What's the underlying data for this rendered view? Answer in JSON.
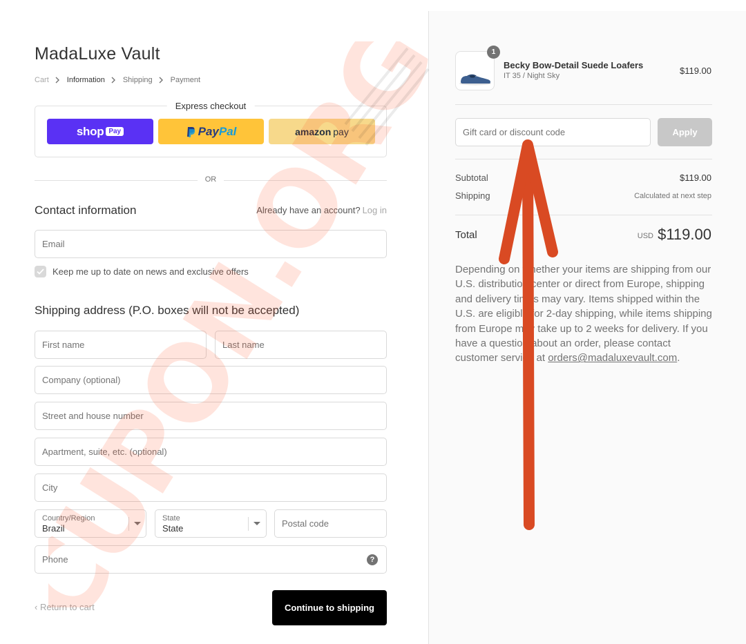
{
  "store": {
    "title": "MadaLuxe Vault"
  },
  "breadcrumb": [
    "Cart",
    "Information",
    "Shipping",
    "Payment"
  ],
  "express": {
    "title": "Express checkout",
    "shop_pay": {
      "word": "shop",
      "badge": "Pay"
    },
    "paypal": {
      "p1": "Pay",
      "p2": "Pal"
    },
    "amazon": {
      "word": "amazon",
      "pay": "pay"
    }
  },
  "or_label": "OR",
  "contact": {
    "title": "Contact information",
    "account_prompt": "Already have an account?",
    "login_link": "Log in",
    "email_placeholder": "Email",
    "newsletter_label": "Keep me up to date on news and exclusive offers"
  },
  "shipping": {
    "title": "Shipping address (P.O. boxes will not be accepted)",
    "first_name": "First name",
    "last_name": "Last name",
    "company": "Company (optional)",
    "street": "Street and house number",
    "apartment": "Apartment, suite, etc. (optional)",
    "city": "City",
    "country": {
      "label": "Country/Region",
      "value": "Brazil"
    },
    "state": {
      "label": "State",
      "value": "State"
    },
    "postal": "Postal code",
    "phone": "Phone"
  },
  "footer": {
    "return_link": "Return to cart",
    "continue_button": "Continue to shipping"
  },
  "summary": {
    "product": {
      "quantity": "1",
      "name": "Becky Bow-Detail Suede Loafers",
      "variant": "IT 35 / Night Sky",
      "price": "$119.00"
    },
    "discount_placeholder": "Gift card or discount code",
    "apply_button": "Apply",
    "subtotal_label": "Subtotal",
    "subtotal_value": "$119.00",
    "shipping_label": "Shipping",
    "shipping_value": "Calculated at next step",
    "total_label": "Total",
    "total_currency": "USD",
    "total_value": "$119.00",
    "note_before": "Depending on whether your items are shipping from our U.S. distribution center or direct from Europe, shipping and delivery times may vary. Items shipped within the U.S. are eligible for 2-day shipping, while items shipping from Europe may take up to 2 weeks for delivery. If you have a question about an order, please contact customer service at ",
    "note_email": "orders@madaluxevault.com",
    "note_after": "."
  },
  "watermark": {
    "text": "CUPON.ORG"
  },
  "colors": {
    "shop_pay": "#5a31f4",
    "paypal": "#ffc439",
    "amazon_pay": "#f7d98b",
    "continue_button": "#000000",
    "arrow": "#d94a23",
    "watermark": "#ff5a2a"
  }
}
